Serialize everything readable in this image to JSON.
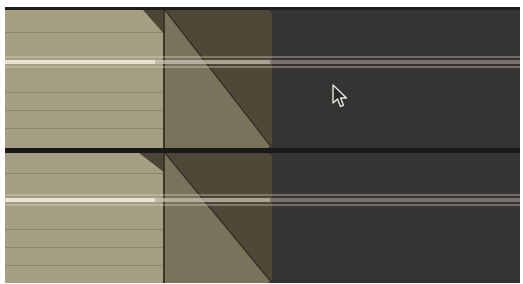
{
  "timeline": {
    "tracks": [
      {
        "id": "track-1",
        "clip": "audio-clip",
        "transition": "cross-dissolve"
      },
      {
        "id": "track-2",
        "clip": "audio-clip",
        "transition": "cross-dissolve"
      }
    ]
  },
  "colors": {
    "clip": "#a69e82",
    "transition": "#6e6650",
    "empty_track": "#363433",
    "background": "#1e1d1c"
  },
  "icons": {
    "cursor": "mouse-pointer-icon"
  }
}
